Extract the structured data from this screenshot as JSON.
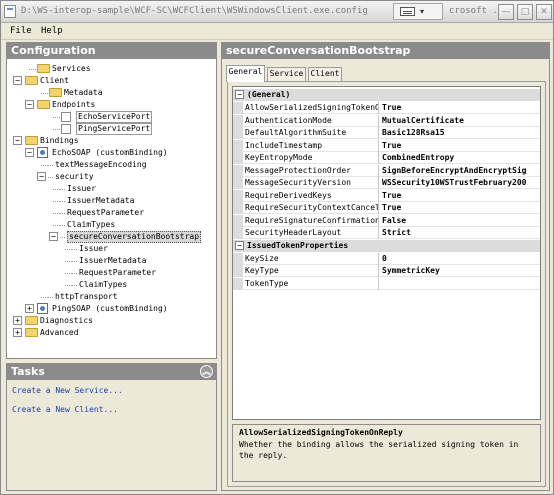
{
  "window": {
    "title": "D:\\WS-interop-sample\\WCF-SC\\WCFClient\\WSWindowsClient.exe.config",
    "title_tail": "crosoft ...",
    "input_indicator": "▾"
  },
  "menu": {
    "file": "File",
    "help": "Help"
  },
  "config_pane": {
    "title": "Configuration",
    "tree": [
      {
        "label": "Services",
        "depth": 1,
        "icon": "folder",
        "expander": null
      },
      {
        "label": "Client",
        "depth": 0,
        "icon": "folder",
        "expander": "-"
      },
      {
        "label": "Metadata",
        "depth": 2,
        "icon": "folder",
        "expander": null
      },
      {
        "label": "Endpoints",
        "depth": 1,
        "icon": "folder",
        "expander": "-"
      },
      {
        "label": "EchoServicePort",
        "depth": 3,
        "icon": "page",
        "expander": null,
        "boxed": true
      },
      {
        "label": "PingServicePort",
        "depth": 3,
        "icon": "page",
        "expander": null,
        "boxed": true
      },
      {
        "label": "Bindings",
        "depth": 0,
        "icon": "folder",
        "expander": "-"
      },
      {
        "label": "EchoSOAP (customBinding)",
        "depth": 1,
        "icon": "config",
        "expander": "-"
      },
      {
        "label": "textMessageEncoding",
        "depth": 2,
        "icon": null,
        "expander": null
      },
      {
        "label": "security",
        "depth": 2,
        "icon": null,
        "expander": "-"
      },
      {
        "label": "Issuer",
        "depth": 3,
        "icon": null,
        "expander": null
      },
      {
        "label": "IssuerMetadata",
        "depth": 3,
        "icon": null,
        "expander": null
      },
      {
        "label": "RequestParameter",
        "depth": 3,
        "icon": null,
        "expander": null
      },
      {
        "label": "ClaimTypes",
        "depth": 3,
        "icon": null,
        "expander": null
      },
      {
        "label": "secureConversationBootstrap",
        "depth": 3,
        "icon": null,
        "expander": "-",
        "selected": true
      },
      {
        "label": "Issuer",
        "depth": 4,
        "icon": null,
        "expander": null
      },
      {
        "label": "IssuerMetadata",
        "depth": 4,
        "icon": null,
        "expander": null
      },
      {
        "label": "RequestParameter",
        "depth": 4,
        "icon": null,
        "expander": null
      },
      {
        "label": "ClaimTypes",
        "depth": 4,
        "icon": null,
        "expander": null
      },
      {
        "label": "httpTransport",
        "depth": 2,
        "icon": null,
        "expander": null
      },
      {
        "label": "PingSOAP (customBinding)",
        "depth": 1,
        "icon": "config",
        "expander": "+"
      },
      {
        "label": "Diagnostics",
        "depth": 0,
        "icon": "folder",
        "expander": "+"
      },
      {
        "label": "Advanced",
        "depth": 0,
        "icon": "folder",
        "expander": "+"
      }
    ]
  },
  "tasks_pane": {
    "title": "Tasks",
    "links": [
      "Create a New Service...",
      "Create a New Client..."
    ]
  },
  "detail_pane": {
    "title": "secureConversationBootstrap",
    "tabs": [
      "General",
      "Service",
      "Client"
    ],
    "active_tab": "General",
    "categories": [
      {
        "name": "(General)",
        "rows": [
          {
            "name": "AllowSerializedSigningTokenOnR",
            "value": "True"
          },
          {
            "name": "AuthenticationMode",
            "value": "MutualCertificate"
          },
          {
            "name": "DefaultAlgorithmSuite",
            "value": "Basic128Rsa15"
          },
          {
            "name": "IncludeTimestamp",
            "value": "True"
          },
          {
            "name": "KeyEntropyMode",
            "value": "CombinedEntropy"
          },
          {
            "name": "MessageProtectionOrder",
            "value": "SignBeforeEncryptAndEncryptSig"
          },
          {
            "name": "MessageSecurityVersion",
            "value": "WSSecurity10WSTrustFebruary200"
          },
          {
            "name": "RequireDerivedKeys",
            "value": "True"
          },
          {
            "name": "RequireSecurityContextCancella",
            "value": "True"
          },
          {
            "name": "RequireSignatureConfirmation",
            "value": "False"
          },
          {
            "name": "SecurityHeaderLayout",
            "value": "Strict"
          }
        ]
      },
      {
        "name": "IssuedTokenProperties",
        "rows": [
          {
            "name": "KeySize",
            "value": "0"
          },
          {
            "name": "KeyType",
            "value": "SymmetricKey"
          },
          {
            "name": "TokenType",
            "value": ""
          }
        ]
      }
    ],
    "description": {
      "title": "AllowSerializedSigningTokenOnReply",
      "text": "Whether the binding allows the serialized signing token in the reply."
    }
  }
}
